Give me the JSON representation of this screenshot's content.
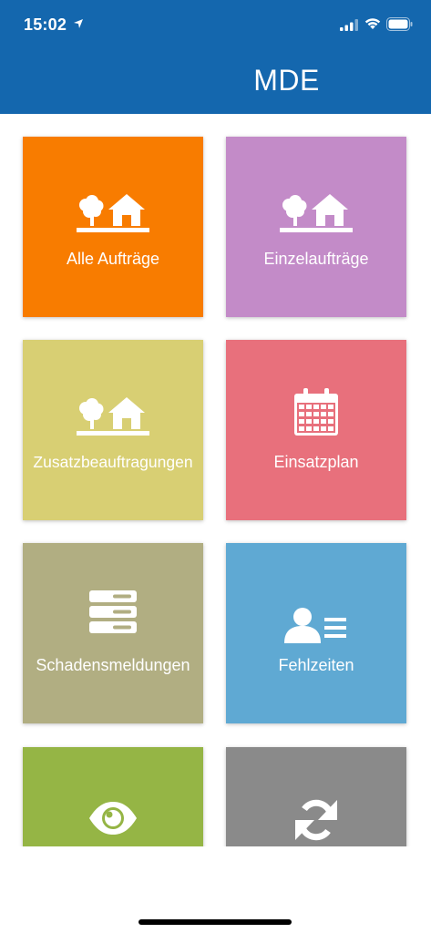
{
  "status": {
    "time": "15:02"
  },
  "header": {
    "title": "MDE"
  },
  "colors": {
    "header": "#1467ae",
    "alle": "#f87c00",
    "einzel": "#c38bc8",
    "zusatz": "#d8cf73",
    "einsatz": "#e8707c",
    "schaden": "#b1ae82",
    "fehl": "#5fa9d3",
    "green": "#95b545",
    "gray": "#8a8a8a"
  },
  "tiles": [
    {
      "label": "Alle Aufträge",
      "icon": "tree-house-icon"
    },
    {
      "label": "Einzelaufträge",
      "icon": "tree-house-icon"
    },
    {
      "label": "Zusatzbeauftragungen",
      "icon": "tree-house-icon"
    },
    {
      "label": "Einsatzplan",
      "icon": "calendar-icon"
    },
    {
      "label": "Schadensmeldungen",
      "icon": "server-stack-icon"
    },
    {
      "label": "Fehlzeiten",
      "icon": "user-list-icon"
    },
    {
      "label": "",
      "icon": "eye-icon"
    },
    {
      "label": "",
      "icon": "sync-icon"
    }
  ]
}
